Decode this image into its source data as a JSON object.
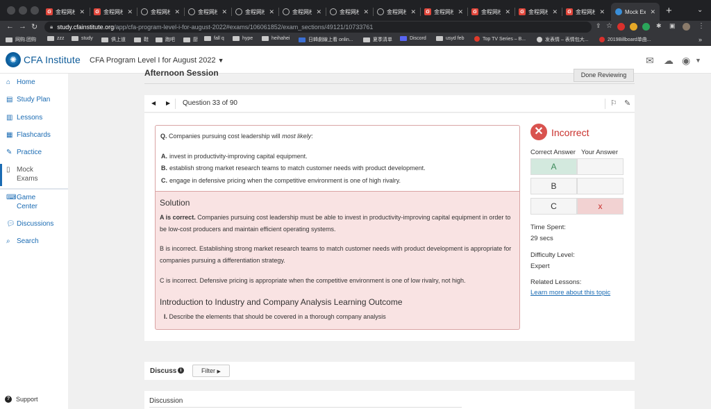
{
  "browser": {
    "tabs": [
      {
        "label": "金程网校",
        "icon": "g"
      },
      {
        "label": "金程网校",
        "icon": "g"
      },
      {
        "label": "金程网校",
        "icon": "o"
      },
      {
        "label": "金程网校",
        "icon": "o"
      },
      {
        "label": "金程网校",
        "icon": "o"
      },
      {
        "label": "金程网校",
        "icon": "o"
      },
      {
        "label": "金程网校",
        "icon": "o"
      },
      {
        "label": "金程网校",
        "icon": "o"
      },
      {
        "label": "金程网校",
        "icon": "g"
      },
      {
        "label": "金程网校",
        "icon": "g"
      },
      {
        "label": "金程网校",
        "icon": "g"
      },
      {
        "label": "金程网校",
        "icon": "g"
      }
    ],
    "active_tab": "Mock Ex",
    "url_host": "study.cfainstitute.org",
    "url_path": "/app/cfa-program-level-i-for-august-2022#exams/106061852/exam_sections/49121/10733761",
    "bookmarks": [
      "网购.团购",
      "zzz",
      "study",
      "俱上道",
      "鞋",
      "跑吧",
      "厨",
      "fall q",
      "hype",
      "heihahei",
      "日韓劇線上看 onlin...",
      "夏季清单",
      "Discord",
      "usyd feb",
      "Top TV Series – B...",
      "发表情 – 表情包大...",
      "2019Billboard单曲..."
    ]
  },
  "header": {
    "logo_text": "CFA Institute",
    "program": "CFA Program Level I for August 2022"
  },
  "sidebar": {
    "items": [
      {
        "label": "Home",
        "icon": "home-icon"
      },
      {
        "label": "Study Plan",
        "icon": "calendar-icon"
      },
      {
        "label": "Lessons",
        "icon": "book-icon"
      },
      {
        "label": "Flashcards",
        "icon": "cards-icon"
      },
      {
        "label": "Practice",
        "icon": "edit-icon"
      },
      {
        "label": "Mock",
        "label2": "Exams",
        "icon": "document-icon"
      },
      {
        "label": "Game",
        "label2": "Center",
        "icon": "gamepad-icon"
      },
      {
        "label": "Discussions",
        "icon": "chat-icon"
      },
      {
        "label": "Search",
        "icon": "search-icon"
      }
    ],
    "support": "Support"
  },
  "session": {
    "title": "Afternoon Session",
    "done_button": "Done Reviewing"
  },
  "question": {
    "counter": "Question 33 of 90",
    "prefix": "Q.",
    "stem": "Companies pursuing cost leadership will",
    "stem_emph": "most likely",
    "stem_end": ":",
    "options": [
      {
        "letter": "A.",
        "text": "invest in productivity-improving capital equipment."
      },
      {
        "letter": "B.",
        "text": "establish strong market research teams to match customer needs with product development."
      },
      {
        "letter": "C.",
        "text": "engage in defensive pricing when the competitive environment is one of high rivalry."
      }
    ]
  },
  "solution": {
    "heading": "Solution",
    "p1_bold": "A is correct.",
    "p1": " Companies pursuing cost leadership must be able to invest in productivity-improving capital equipment in order to be low-cost producers and maintain efficient operating systems.",
    "p2": "B is incorrect. Establishing strong market research teams to match customer needs with product development is appropriate for companies pursuing a differentiation strategy.",
    "p3": "C is incorrect. Defensive pricing is appropriate when the competitive environment is one of low rivalry, not high.",
    "learning_heading": "Introduction to Industry and Company Analysis Learning Outcome",
    "learning_num": "I.",
    "learning_item": "Describe the elements that should be covered in a thorough company analysis"
  },
  "result": {
    "status": "Incorrect",
    "correct_col": "Correct Answer",
    "your_col": "Your Answer",
    "rows": [
      {
        "letter": "A",
        "your": ""
      },
      {
        "letter": "B",
        "your": ""
      },
      {
        "letter": "C",
        "your": "x"
      }
    ],
    "time_label": "Time Spent:",
    "time_value": "29 secs",
    "difficulty_label": "Difficulty Level:",
    "difficulty_value": "Expert",
    "related_label": "Related Lessons:",
    "related_link": "Learn more about this topic"
  },
  "discuss": {
    "label": "Discuss",
    "filter": "Filter",
    "discussion_label": "Discussion"
  },
  "colors": {
    "brand": "#1a6bb3",
    "incorrect": "#d9534f",
    "correct_bg": "#d3e9de",
    "wrong_bg": "#f2d2d2",
    "solution_bg": "#f9e3e3"
  }
}
